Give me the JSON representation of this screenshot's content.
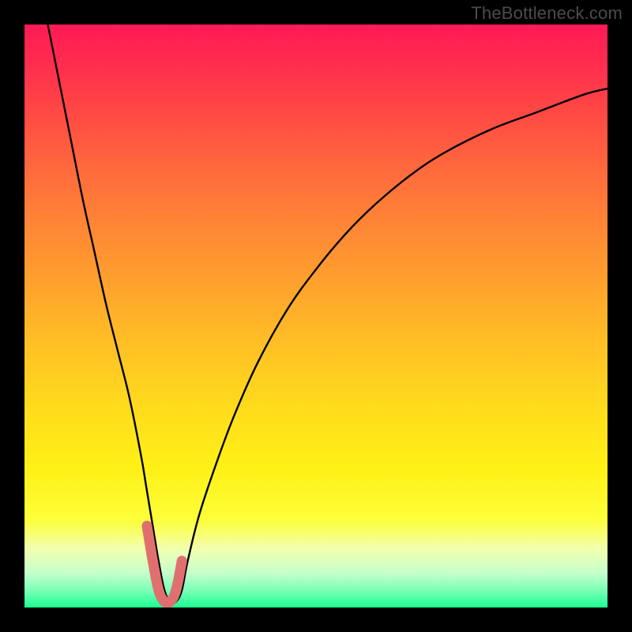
{
  "watermark": "TheBottleneck.com",
  "chart_data": {
    "type": "line",
    "title": "",
    "xlabel": "",
    "ylabel": "",
    "xlim": [
      0,
      100
    ],
    "ylim": [
      0,
      100
    ],
    "series": [
      {
        "name": "curve",
        "x": [
          4,
          6,
          8,
          10,
          12,
          14,
          16,
          18,
          20,
          21,
          22,
          23,
          24,
          25,
          26,
          27,
          28,
          30,
          33,
          36,
          40,
          45,
          50,
          55,
          60,
          66,
          72,
          80,
          88,
          96,
          100
        ],
        "values": [
          100,
          90,
          80,
          70,
          61,
          52,
          44,
          36,
          26,
          20,
          14,
          8,
          3,
          1,
          1,
          3,
          8,
          16,
          25,
          33,
          42,
          51,
          58,
          64,
          69,
          74,
          78,
          82,
          85,
          88,
          89
        ]
      },
      {
        "name": "highlighted-bottom",
        "x": [
          21,
          22,
          23,
          24,
          25,
          26,
          27
        ],
        "values": [
          14,
          8,
          3,
          1,
          1,
          3,
          8
        ]
      }
    ],
    "highlight_color": "#e07070",
    "curve_color": "#000000"
  }
}
